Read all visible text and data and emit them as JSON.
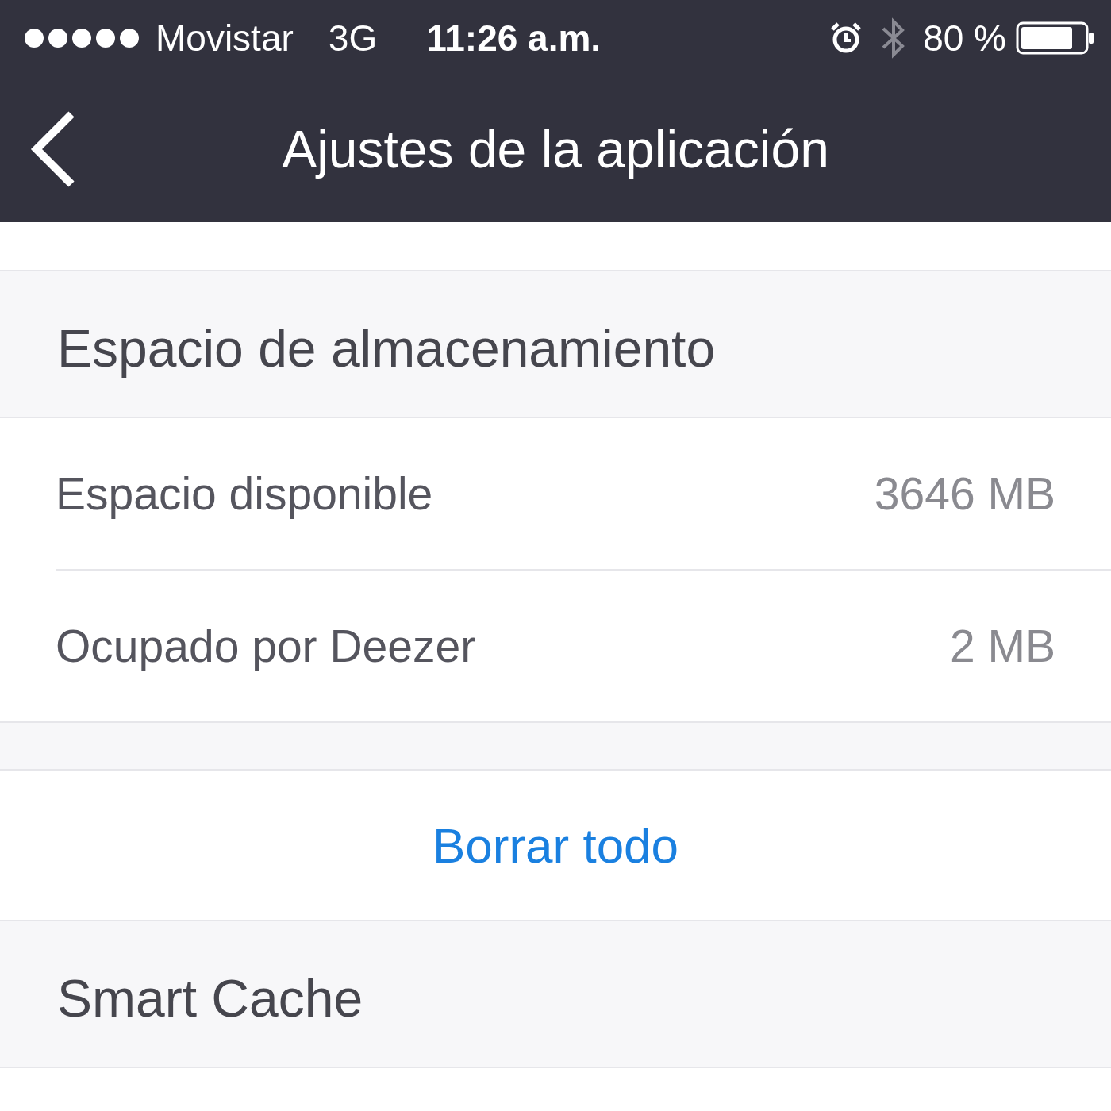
{
  "status_bar": {
    "carrier": "Movistar",
    "network": "3G",
    "time": "11:26 a.m.",
    "battery": "80 %"
  },
  "nav_bar": {
    "title": "Ajustes de la aplicación"
  },
  "sections": [
    {
      "kind": "rows",
      "header": "Espacio de almacenamiento",
      "rows": [
        {
          "label": "Espacio disponible",
          "value": "3646 MB"
        },
        {
          "label": "Ocupado por Deezer",
          "value": "2 MB"
        }
      ]
    },
    {
      "kind": "action",
      "label": "Borrar todo"
    },
    {
      "kind": "header",
      "header": "Smart Cache"
    }
  ]
}
